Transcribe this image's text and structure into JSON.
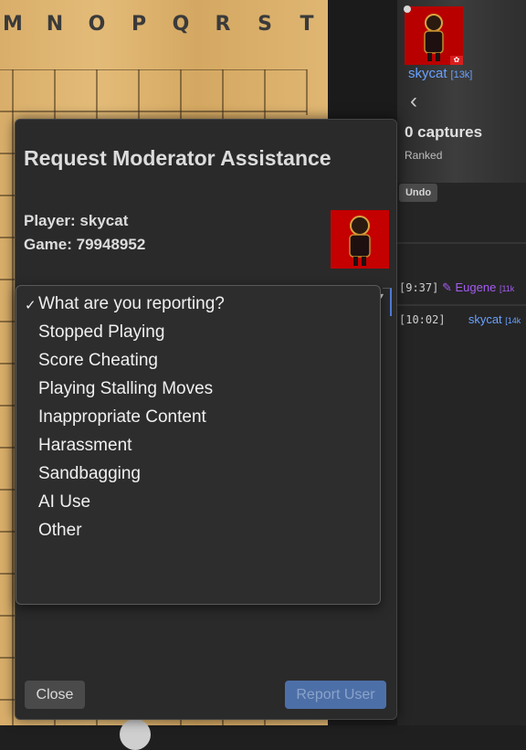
{
  "board": {
    "column_labels": [
      "M",
      "N",
      "O",
      "P",
      "Q",
      "R",
      "S",
      "T"
    ]
  },
  "player_card": {
    "name": "skycat",
    "rank": "[13k]",
    "captures": "0 captures",
    "status": "Ranked",
    "undo_label": "Undo"
  },
  "chat": [
    {
      "time": "[9:37]",
      "user": "Eugene",
      "rank": "[11k",
      "icon": "wrench-icon"
    },
    {
      "time": "[10:02]",
      "user": "skycat",
      "rank": "[14k"
    }
  ],
  "modal": {
    "title": "Request Moderator Assistance",
    "player_line": "Player: skycat",
    "game_line": "Game: 79948952",
    "dropdown": {
      "selected_check": "✓",
      "options": [
        "What are you reporting?",
        "Stopped Playing",
        "Score Cheating",
        "Playing Stalling Moves",
        "Inappropriate Content",
        "Harassment",
        "Sandbagging",
        "AI Use",
        "Other"
      ]
    },
    "close_label": "Close",
    "report_label": "Report User"
  },
  "colors": {
    "accent": "#6aa1ff",
    "moderator": "#a45cf0",
    "report_button": "#4d6fa8"
  }
}
